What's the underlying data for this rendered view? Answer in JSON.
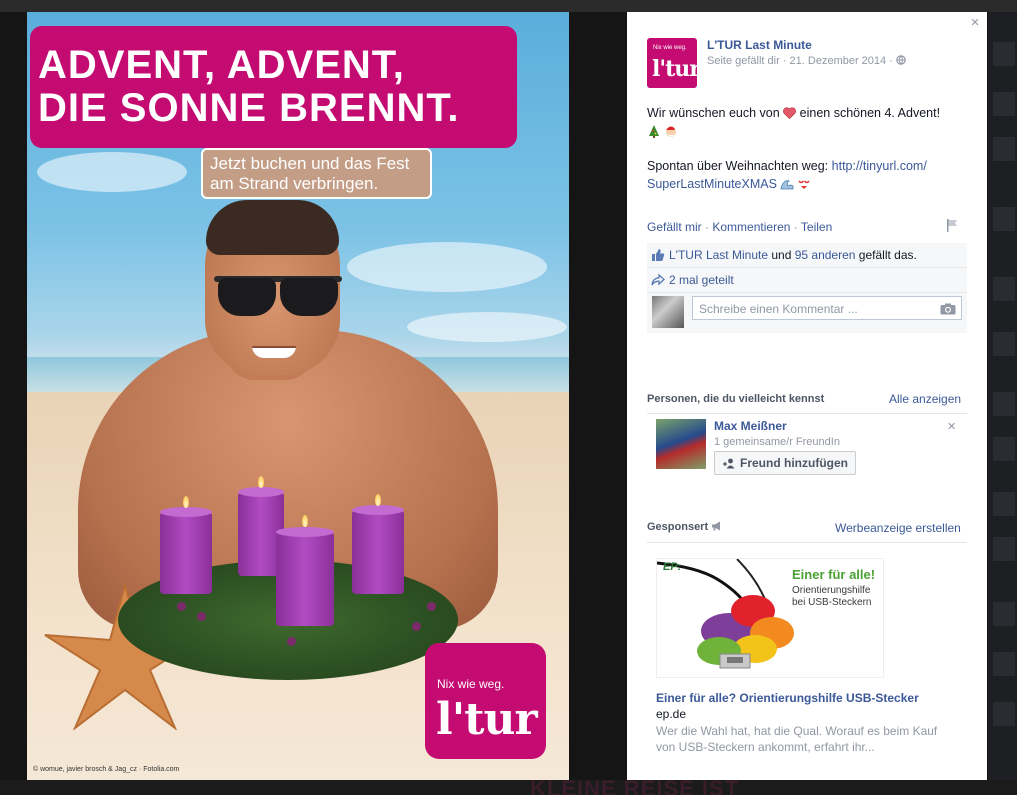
{
  "photo": {
    "headline_line1": "ADVENT, ADVENT,",
    "headline_line2": "DIE SONNE BRENNT.",
    "sub_line1": "Jetzt buchen und das Fest",
    "sub_line2": "am Strand verbringen.",
    "logo_tagline": "Nix wie weg.",
    "logo_word": "l'tur",
    "credit": "© womue, javier brosch & Jag_cz · Fotolia.com",
    "brand_color": "#c30b72"
  },
  "post": {
    "close_label": "×",
    "avatar_tagline": "Nix wie weg.",
    "avatar_word": "l'tur",
    "page_name": "L'TUR Last Minute",
    "meta": "Seite gefällt dir · 21. Dezember 2014 ·",
    "text_line1": "Wir wünschen euch von",
    "text_line1_end": "einen schönen 4. Advent!",
    "text_line3": "Spontan über Weihnachten weg:",
    "link_part1": "http://tinyurl.com/",
    "link_part2": "SuperLastMinuteXMAS",
    "actions": {
      "like": "Gefällt mir",
      "comment": "Kommentieren",
      "share": "Teilen"
    },
    "likes": {
      "liker": "L'TUR Last Minute",
      "and": "und",
      "others": "95 anderen",
      "suffix": "gefällt das."
    },
    "shares": "2 mal geteilt",
    "comment_placeholder": "Schreibe einen Kommentar ..."
  },
  "pymk": {
    "title": "Personen, die du vielleicht kennst",
    "see_all": "Alle anzeigen",
    "name": "Max Meißner",
    "mutual": "1 gemeinsame/r FreundIn",
    "add_button": "Freund hinzufügen"
  },
  "sponsored": {
    "title": "Gesponsert",
    "create_ad": "Werbeanzeige erstellen",
    "ad_brand": "EP:",
    "ad_image_title": "Einer für alle!",
    "ad_image_sub1": "Orientierungshilfe",
    "ad_image_sub2": "bei USB-Steckern",
    "ad_headline": "Einer für alle? Orientierungshilfe USB-Stecker",
    "ad_domain": "ep.de",
    "ad_desc": "Wer die Wahl hat, hat die Qual. Worauf es beim Kauf von USB-Steckern ankommt, erfahrt ihr..."
  },
  "background": {
    "banner_text": "KLEINE REISE IST"
  },
  "icons": [
    "close-icon",
    "globe-icon",
    "heart-icon",
    "christmas-tree-icon",
    "santa-icon",
    "wave-icon",
    "bikini-icon",
    "flag-icon",
    "thumbs-up-icon",
    "share-arrow-icon",
    "camera-icon",
    "add-friend-icon",
    "megaphone-icon"
  ]
}
